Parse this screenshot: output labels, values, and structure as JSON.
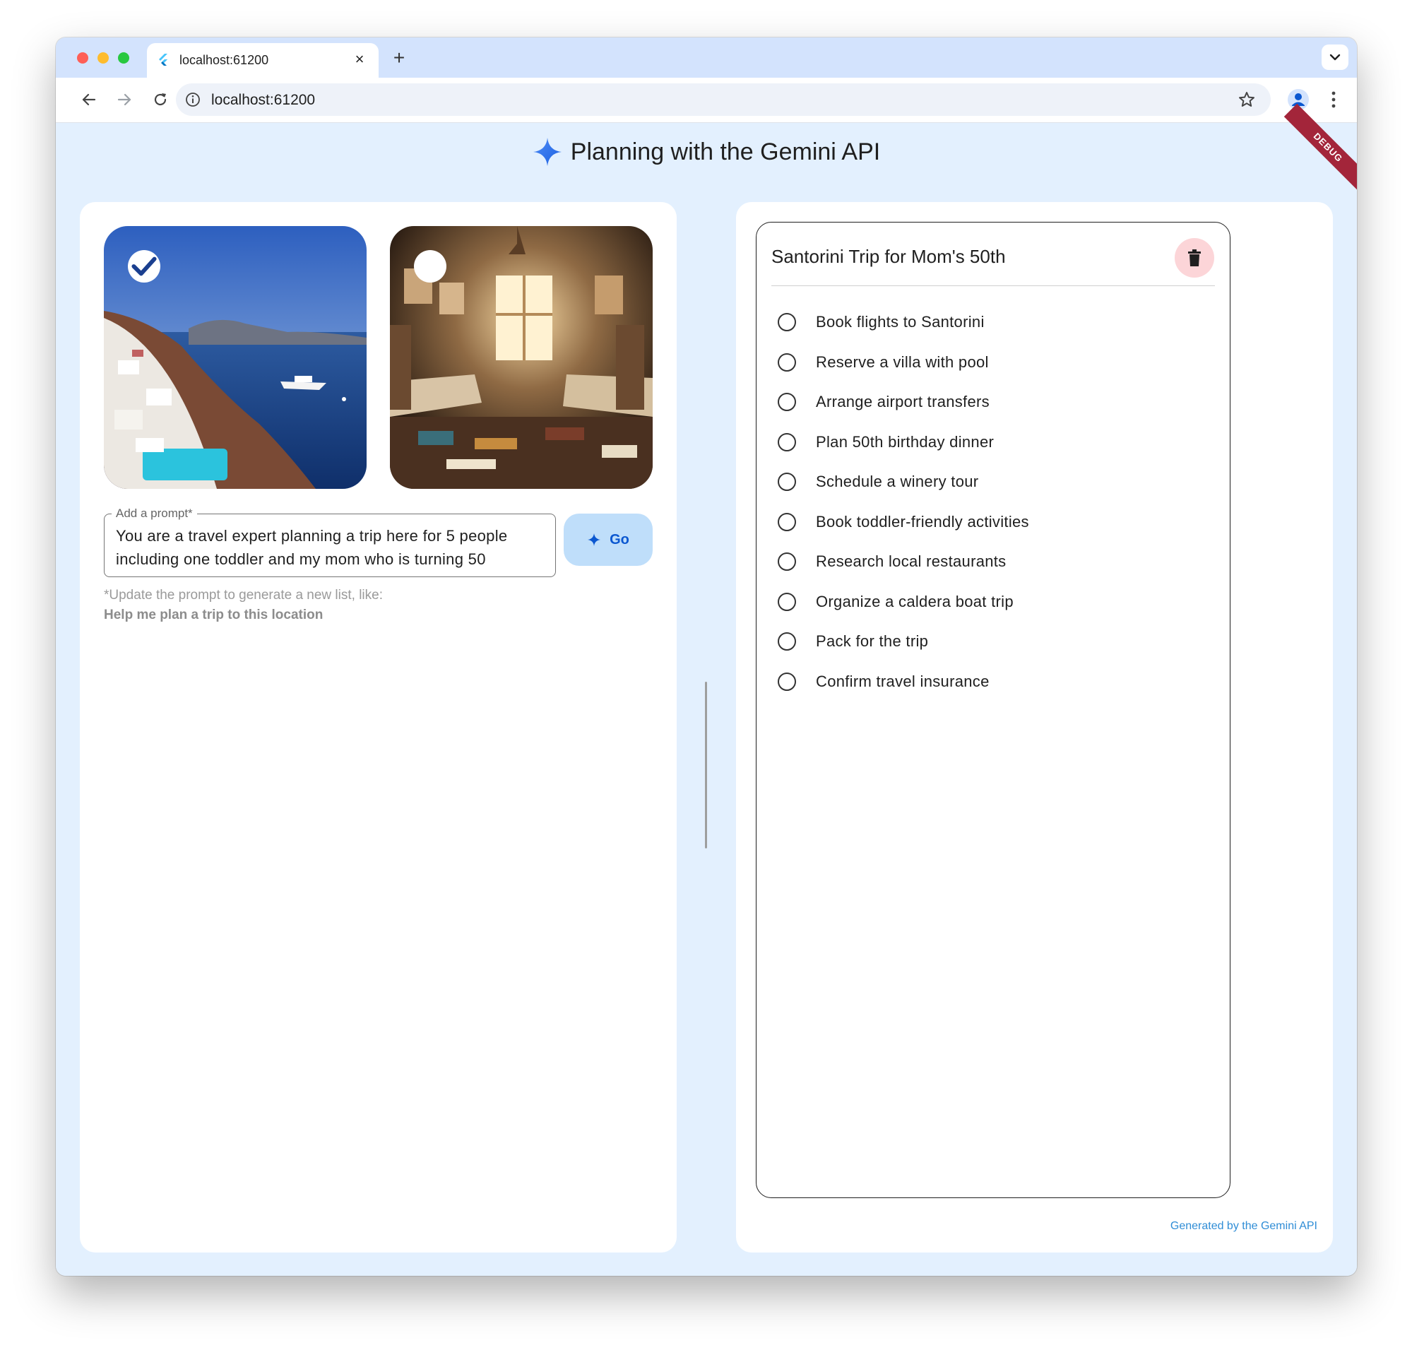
{
  "browser": {
    "tab_title": "localhost:61200",
    "tab_close": "×",
    "new_tab": "+",
    "url": "localhost:61200"
  },
  "app": {
    "title": "Planning with the Gemini API",
    "debug_banner": "DEBUG"
  },
  "images": [
    {
      "name": "santorini-coast",
      "selected": true
    },
    {
      "name": "cluttered-bedroom",
      "selected": false
    }
  ],
  "prompt": {
    "label": "Add a prompt*",
    "value": "You are a travel expert planning a trip here for 5 people including one toddler and my mom who is turning 50",
    "hint_line1": "*Update the prompt to generate a new list, like:",
    "hint_line2": "Help me plan a trip to this location"
  },
  "go_button": {
    "label": "Go"
  },
  "todo_list": {
    "title": "Santorini Trip for Mom's 50th",
    "items": [
      {
        "label": "Book flights to Santorini",
        "done": false
      },
      {
        "label": "Reserve a villa with pool",
        "done": false
      },
      {
        "label": "Arrange airport transfers",
        "done": false
      },
      {
        "label": "Plan 50th birthday dinner",
        "done": false
      },
      {
        "label": "Schedule a winery tour",
        "done": false
      },
      {
        "label": "Book toddler-friendly activities",
        "done": false
      },
      {
        "label": "Research local restaurants",
        "done": false
      },
      {
        "label": "Organize a caldera boat trip",
        "done": false
      },
      {
        "label": "Pack for the trip",
        "done": false
      },
      {
        "label": "Confirm travel insurance",
        "done": false
      }
    ]
  },
  "footer": {
    "credit": "Generated by the Gemini API"
  },
  "colors": {
    "background": "#e3f0fe",
    "accent": "#0b57d0",
    "go_button_bg": "#bfdefa",
    "delete_button_bg": "#fcd5d8",
    "credit_link": "#2f8dd6"
  }
}
